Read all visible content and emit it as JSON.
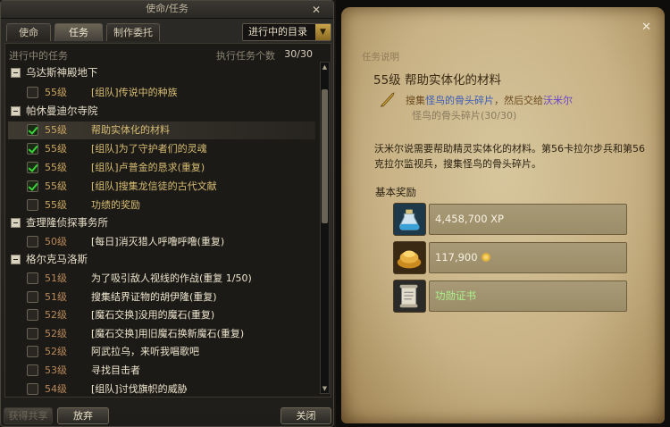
{
  "left_window": {
    "title": "使命/任务",
    "tabs": [
      {
        "label": "使命",
        "active": false
      },
      {
        "label": "任务",
        "active": true
      },
      {
        "label": "制作委托",
        "active": false
      }
    ],
    "dropdown_value": "进行中的目录",
    "list_header": {
      "label": "进行中的任务",
      "count_label": "执行任务个数",
      "count_value": "30/30"
    },
    "groups": [
      {
        "name": "乌达斯神殿地下",
        "quests": [
          {
            "level": "55级",
            "name": "[组队]传说中的种族",
            "checked": false
          }
        ]
      },
      {
        "name": "帕休曼迪尔寺院",
        "quests": [
          {
            "level": "55级",
            "name": "帮助实体化的材料",
            "checked": true,
            "selected": true
          },
          {
            "level": "55级",
            "name": "[组队]为了守护者们的灵魂",
            "checked": true
          },
          {
            "level": "55级",
            "name": "[组队]卢普金的恳求(重复)",
            "checked": true
          },
          {
            "level": "55级",
            "name": "[组队]搜集龙信徒的古代文献",
            "checked": true
          },
          {
            "level": "55级",
            "name": "功绩的奖励",
            "checked": false
          }
        ]
      },
      {
        "name": "查理隆侦探事务所",
        "quests": [
          {
            "level": "50级",
            "name": "[每日]消灭猎人呼噜呼噜(重复)",
            "checked": false
          }
        ]
      },
      {
        "name": "格尔克马洛斯",
        "quests": [
          {
            "level": "51级",
            "name": "为了吸引敌人视线的作战(重复 1/50)",
            "checked": false
          },
          {
            "level": "51级",
            "name": "搜集结界证物的胡伊隆(重复)",
            "checked": false
          },
          {
            "level": "52级",
            "name": "[魔石交换]没用的魔石(重复)",
            "checked": false
          },
          {
            "level": "52级",
            "name": "[魔石交换]用旧魔石换新魔石(重复)",
            "checked": false
          },
          {
            "level": "52级",
            "name": "阿武拉乌，来听我唱歌吧",
            "checked": false
          },
          {
            "level": "53级",
            "name": "寻找目击者",
            "checked": false
          },
          {
            "level": "54级",
            "name": "[组队]讨伐旗帜的威胁",
            "checked": false
          }
        ]
      }
    ],
    "buttons": {
      "share": "获得共享",
      "abandon": "放弃",
      "close": "关闭"
    }
  },
  "right_window": {
    "section_label": "任务说明",
    "title": "55级  帮助实体化的材料",
    "objective": {
      "prefix": "搜集",
      "target": "怪鸟的骨头碎片",
      "middle": "，然后交给",
      "npc": "沃米尔",
      "progress": "怪鸟的骨头碎片(30/30)"
    },
    "description": "沃米尔说需要帮助精灵实体化的材料。第56卡拉尔步兵和第56克拉尔监视兵，搜集怪鸟的骨头碎片。",
    "reward_label": "基本奖励",
    "rewards": {
      "xp": "4,458,700 XP",
      "gold": "117,900",
      "item": "功勋证书"
    },
    "colors": {
      "target": "#3a5cb8",
      "npc": "#6a44c8",
      "item_reward": "#a8f08a"
    }
  }
}
